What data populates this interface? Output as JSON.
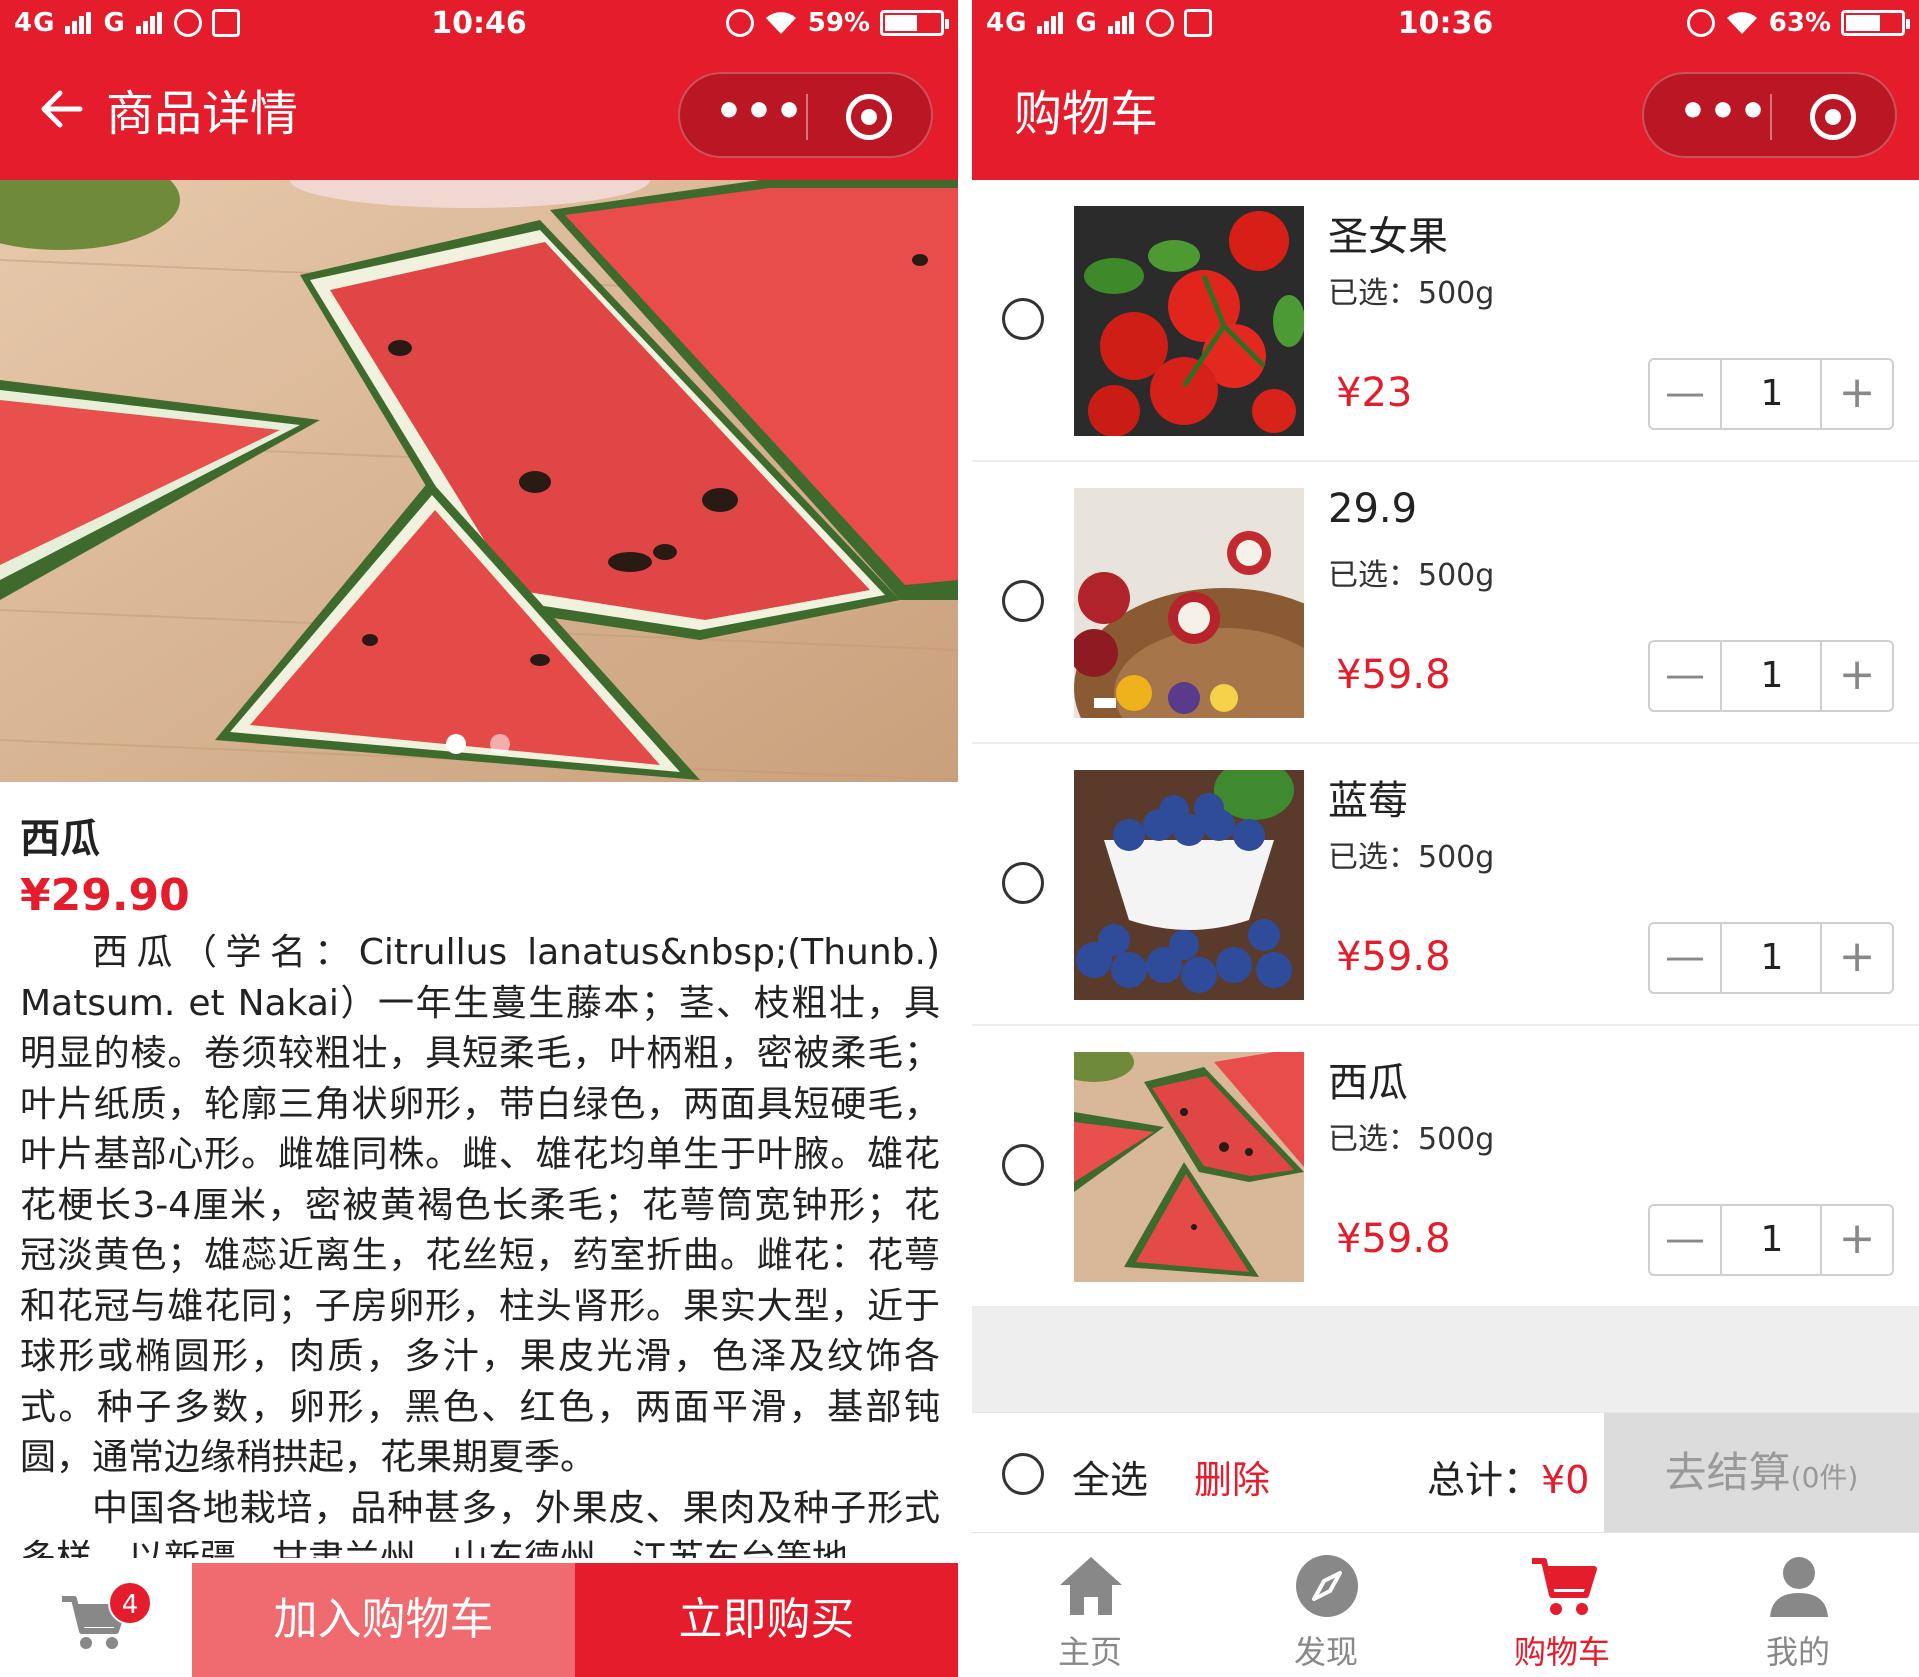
{
  "left_screen": {
    "status_bar": {
      "network": "4G",
      "network2": "G",
      "time": "10:46",
      "battery": "59%",
      "battery_level": 0.59
    },
    "nav": {
      "back_icon": "arrow-left-icon",
      "title": "商品详情",
      "more_icon": "more-dots-icon",
      "close_icon": "target-icon"
    },
    "carousel": {
      "image": "watermelon-slices-photo",
      "page_count": 2,
      "active_index": 0
    },
    "product": {
      "name": "西瓜",
      "price": "¥29.90",
      "description_p1": "西瓜（学名：Citrullus lanatus&nbsp;(Thunb.) Matsum. et Nakai）一年生蔓生藤本；茎、枝粗壮，具明显的棱。卷须较粗壮，具短柔毛，叶柄粗，密被柔毛；叶片纸质，轮廓三角状卵形，带白绿色，两面具短硬毛，叶片基部心形。雌雄同株。雌、雄花均单生于叶腋。雄花花梗长3-4厘米，密被黄褐色长柔毛；花萼筒宽钟形；花冠淡黄色；雄蕊近离生，花丝短，药室折曲。雌花：花萼和花冠与雄花同；子房卵形，柱头肾形。果实大型，近于球形或椭圆形，肉质，多汁，果皮光滑，色泽及纹饰各式。种子多数，卵形，黑色、红色，两面平滑，基部钝圆，通常边缘稍拱起，花果期夏季。",
      "description_p2": "中国各地栽培，品种甚多，外果皮、果肉及种子形式多样，以新疆、甘肃兰州、山东德州、江苏东台等地"
    },
    "bottom_bar": {
      "cart_icon": "cart-icon",
      "cart_badge": "4",
      "add_to_cart": "加入购物车",
      "buy_now": "立即购买"
    }
  },
  "right_screen": {
    "status_bar": {
      "network": "4G",
      "network2": "G",
      "time": "10:36",
      "battery": "63%",
      "battery_level": 0.63
    },
    "nav": {
      "title": "购物车",
      "more_icon": "more-dots-icon",
      "close_icon": "target-icon"
    },
    "cart_items": [
      {
        "name": "圣女果",
        "spec": "已选：500g",
        "price": "¥23",
        "quantity": "1",
        "image": "cherry-tomatoes-photo",
        "minus": "—",
        "plus": "+"
      },
      {
        "name": "29.9",
        "spec": "已选：500g",
        "price": "¥59.8",
        "quantity": "1",
        "image": "rambutan-photo",
        "minus": "—",
        "plus": "+"
      },
      {
        "name": "蓝莓",
        "spec": "已选：500g",
        "price": "¥59.8",
        "quantity": "1",
        "image": "blueberries-photo",
        "minus": "—",
        "plus": "+"
      },
      {
        "name": "西瓜",
        "spec": "已选：500g",
        "price": "¥59.8",
        "quantity": "1",
        "image": "watermelon-photo",
        "minus": "—",
        "plus": "+"
      }
    ],
    "summary": {
      "select_all": "全选",
      "delete": "删除",
      "total_label": "总计：",
      "total_value": "¥0",
      "checkout": "去结算",
      "checkout_count": "(0件)"
    },
    "tabbar": [
      {
        "label": "主页",
        "icon": "home-icon",
        "active": false
      },
      {
        "label": "发现",
        "icon": "compass-icon",
        "active": false
      },
      {
        "label": "购物车",
        "icon": "cart-icon",
        "active": true
      },
      {
        "label": "我的",
        "icon": "user-icon",
        "active": false
      }
    ]
  },
  "colors": {
    "brand_red": "#e51c2b",
    "add_cart_pink": "#ef6b70",
    "checkout_disabled": "#dcdcdc"
  }
}
